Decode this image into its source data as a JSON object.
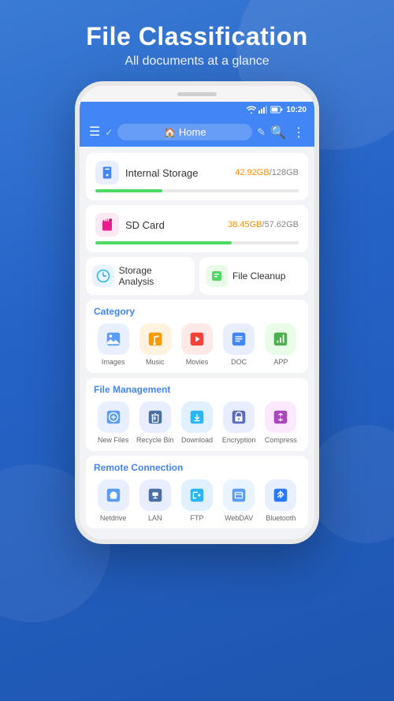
{
  "header": {
    "main_title": "File Classification",
    "sub_title": "All documents at a glance"
  },
  "status_bar": {
    "time": "10:20"
  },
  "app_bar": {
    "home_label": "Home"
  },
  "storage": [
    {
      "name": "Internal Storage",
      "used": "42.92GB",
      "total": "128GB",
      "progress": 33,
      "icon_bg": "#e8eeff",
      "icon_color": "#4285f4",
      "bar_color": "#4cd964"
    },
    {
      "name": "SD Card",
      "used": "38.45GB",
      "total": "57.62GB",
      "progress": 67,
      "icon_bg": "#fce8f3",
      "icon_color": "#e91e8c",
      "bar_color": "#4cd964"
    }
  ],
  "actions": [
    {
      "label": "Storage Analysis",
      "icon_bg": "#e8f4ff",
      "icon": "📊"
    },
    {
      "label": "File Cleanup",
      "icon_bg": "#e8fce8",
      "icon": "🧹"
    }
  ],
  "category": {
    "title": "Category",
    "items": [
      {
        "label": "Images",
        "icon": "🖼️",
        "bg": "#e8f0ff"
      },
      {
        "label": "Music",
        "icon": "🎵",
        "bg": "#fff3e0"
      },
      {
        "label": "Movies",
        "icon": "🎬",
        "bg": "#ffe8e8"
      },
      {
        "label": "DOC",
        "icon": "📄",
        "bg": "#e8eeff"
      },
      {
        "label": "APP",
        "icon": "📱",
        "bg": "#e8fce8"
      }
    ]
  },
  "file_management": {
    "title": "File Management",
    "items": [
      {
        "label": "New Files",
        "icon": "🕐",
        "bg": "#e8f0ff"
      },
      {
        "label": "Recycle Bin",
        "icon": "🗑️",
        "bg": "#e8eeff"
      },
      {
        "label": "Download",
        "icon": "⬇️",
        "bg": "#e0f0ff"
      },
      {
        "label": "Encryption",
        "icon": "🔐",
        "bg": "#e8eeff"
      },
      {
        "label": "Compress",
        "icon": "📦",
        "bg": "#fce8ff"
      }
    ]
  },
  "remote_connection": {
    "title": "Remote Connection",
    "items": [
      {
        "label": "Netdrive",
        "icon": "☁️",
        "bg": "#e8f0ff"
      },
      {
        "label": "LAN",
        "icon": "🖥️",
        "bg": "#e8eeff"
      },
      {
        "label": "FTP",
        "icon": "📁",
        "bg": "#e0f0ff"
      },
      {
        "label": "WebDAV",
        "icon": "📋",
        "bg": "#e8f4ff"
      },
      {
        "label": "Bluetooth",
        "icon": "🔵",
        "bg": "#e8f0ff"
      }
    ]
  }
}
